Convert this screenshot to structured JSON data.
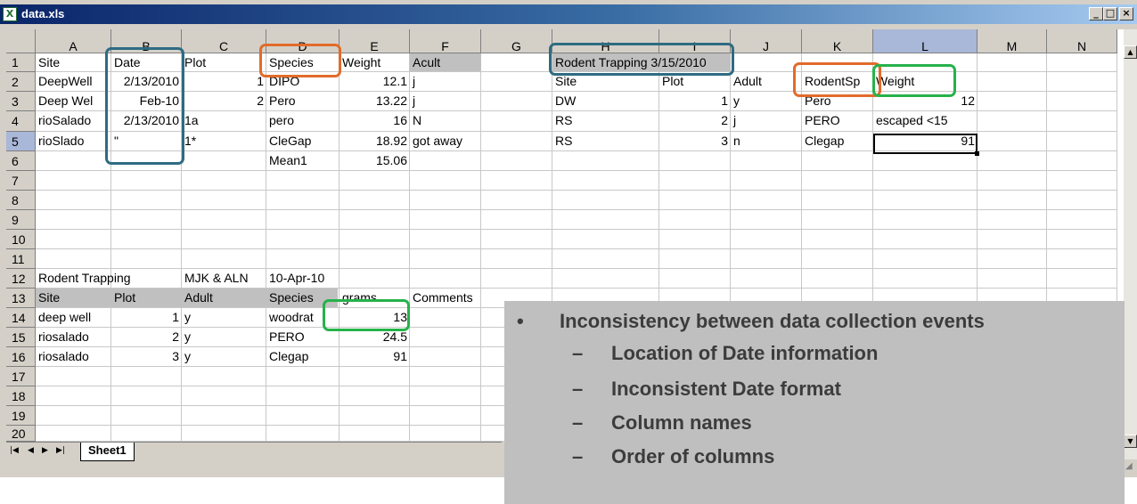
{
  "window": {
    "title": "data.xls"
  },
  "columns": [
    "A",
    "B",
    "C",
    "D",
    "E",
    "F",
    "G",
    "H",
    "I",
    "J",
    "K",
    "L",
    "M",
    "N"
  ],
  "rows": [
    "1",
    "2",
    "3",
    "4",
    "5",
    "6",
    "7",
    "8",
    "9",
    "10",
    "11",
    "12",
    "13",
    "14",
    "15",
    "16",
    "17",
    "18",
    "19",
    "20"
  ],
  "cells": {
    "A1": "Site",
    "B1": "Date",
    "C1": "Plot",
    "D1": "Species",
    "E1": "Weight",
    "F1": "Acult",
    "A2": "DeepWell",
    "B2": "2/13/2010",
    "C2": "1",
    "D2": "DIPO",
    "E2": "12.1",
    "F2": "j",
    "A3": "Deep Wel",
    "B3": "Feb-10",
    "C3": "2",
    "D3": "Pero",
    "E3": "13.22",
    "F3": "j",
    "A4": "rioSalado",
    "B4": "2/13/2010",
    "C4": "1a",
    "D4": "pero",
    "E4": "16",
    "F4": "N",
    "A5": "rioSlado",
    "B5": "\"",
    "C5": "1*",
    "D5": "CleGap",
    "E5": "18.92",
    "F5": "got away",
    "D6": "Mean1",
    "E6": "15.06",
    "H1": "Rodent Trapping 3/15/2010",
    "H2": "Site",
    "I2": "Plot",
    "J2": "Adult",
    "K2": "RodentSp",
    "L2": "Weight",
    "H3": "DW",
    "I3": "1",
    "J3": "y",
    "K3": "Pero",
    "L3": "12",
    "H4": "RS",
    "I4": "2",
    "J4": "j",
    "K4": "PERO",
    "L4": "escaped <15",
    "H5": "RS",
    "I5": "3",
    "J5": "n",
    "K5": "Clegap",
    "L5": "91",
    "A12": "Rodent Trapping",
    "C12": "MJK & ALN",
    "D12": "10-Apr-10",
    "A13": "Site",
    "B13": "Plot",
    "C13": "Adult",
    "D13": "Species",
    "E13": "grams",
    "F13": "Comments",
    "A14": "deep well",
    "B14": "1",
    "C14": "y",
    "D14": "woodrat",
    "E14": "13",
    "A15": "riosalado",
    "B15": "2",
    "C15": "y",
    "D15": "PERO",
    "E15": "24.5",
    "A16": "riosalado",
    "B16": "3",
    "C16": "y",
    "D16": "Clegap",
    "E16": "91"
  },
  "sheet_tab": "Sheet1",
  "callout": {
    "bullet": "Inconsistency between data collection events",
    "sub": [
      "Location of Date information",
      "Inconsistent Date format",
      "Column names",
      "Order of columns"
    ],
    "bullet_mark": "•",
    "dash_mark": "–"
  },
  "colors": {
    "highlight_blue": "#2f6b82",
    "highlight_orange": "#e26b2a",
    "highlight_green": "#26b24b",
    "title_bar": "#0a246a"
  },
  "icons": [
    "excel-app-icon",
    "minimize-icon",
    "maximize-icon",
    "close-icon",
    "first-sheet-icon",
    "prev-sheet-icon",
    "next-sheet-icon",
    "last-sheet-icon",
    "scroll-up-icon",
    "scroll-down-icon",
    "resize-grip-icon"
  ]
}
